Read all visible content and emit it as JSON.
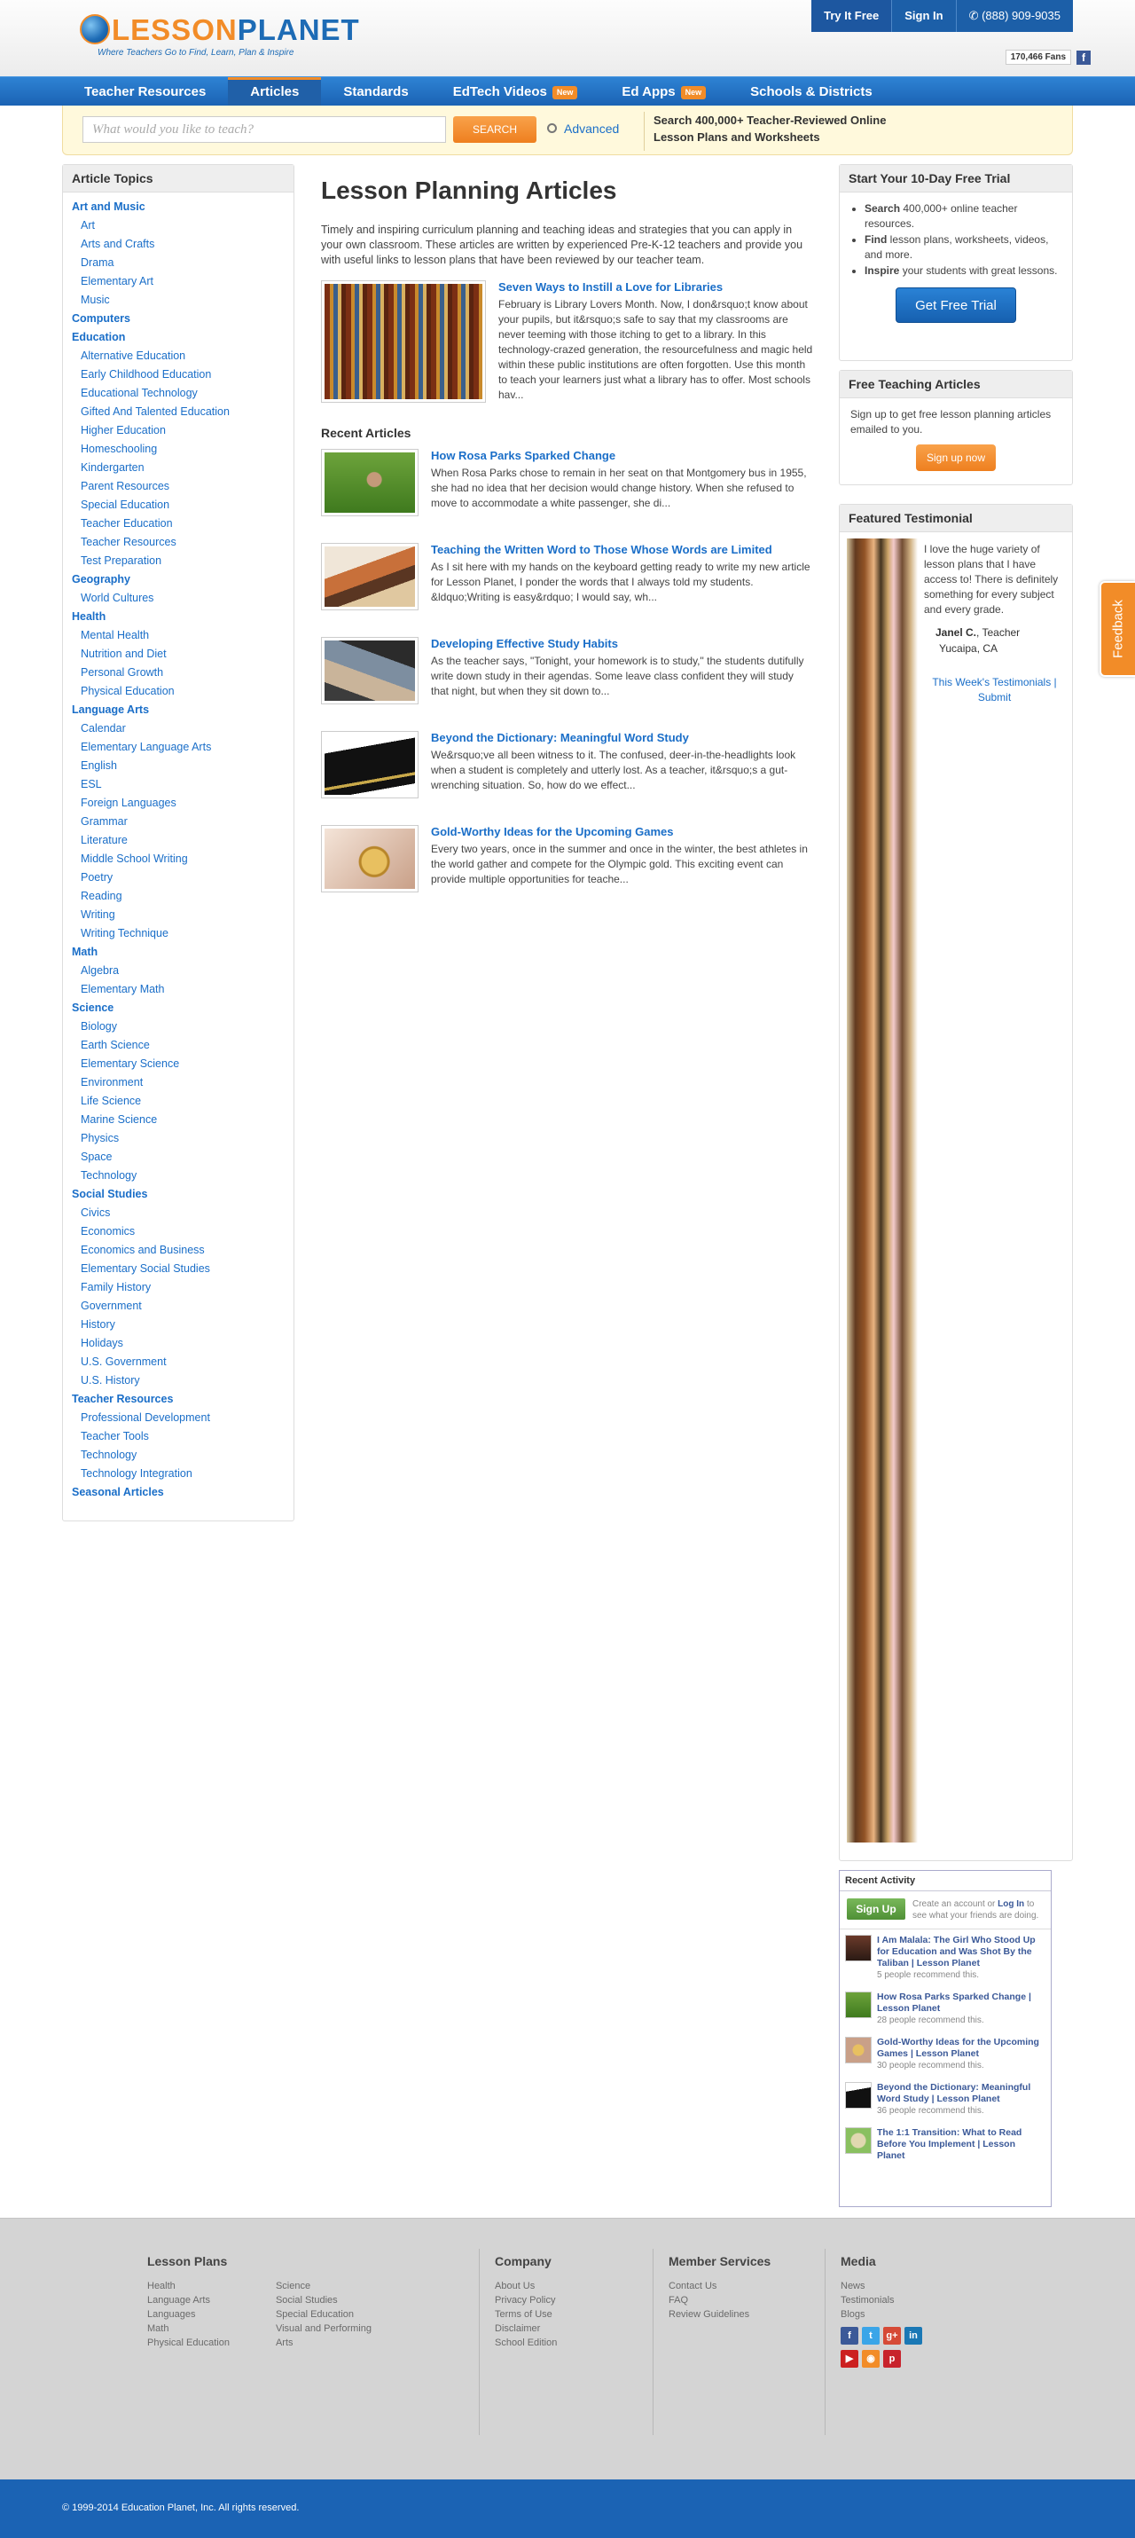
{
  "header": {
    "logo_part1": "LESSON",
    "logo_part2": "PLANET",
    "logo_tagline": "Where Teachers Go to Find, Learn, Plan & Inspire",
    "try_it_free": "Try It Free",
    "sign_in": "Sign In",
    "phone": "(888) 909-9035",
    "fans": "170,466 Fans"
  },
  "nav": {
    "items": [
      {
        "label": "Teacher Resources"
      },
      {
        "label": "Articles"
      },
      {
        "label": "Standards"
      },
      {
        "label": "EdTech Videos",
        "badge": "New"
      },
      {
        "label": "Ed Apps",
        "badge": "New"
      },
      {
        "label": "Schools & Districts"
      }
    ]
  },
  "search": {
    "placeholder": "What would you like to teach?",
    "button": "SEARCH",
    "advanced": "Advanced",
    "promo_line1": "Search 400,000+ Teacher-Reviewed Online",
    "promo_line2": "Lesson Plans and Worksheets"
  },
  "sidebar": {
    "title": "Article Topics",
    "topics": [
      {
        "label": "Art and Music",
        "level": "cat"
      },
      {
        "label": "Art",
        "level": "sub"
      },
      {
        "label": "Arts and Crafts",
        "level": "sub"
      },
      {
        "label": "Drama",
        "level": "sub"
      },
      {
        "label": "Elementary Art",
        "level": "sub"
      },
      {
        "label": "Music",
        "level": "sub"
      },
      {
        "label": "Computers",
        "level": "cat"
      },
      {
        "label": "Education",
        "level": "cat"
      },
      {
        "label": "Alternative Education",
        "level": "sub"
      },
      {
        "label": "Early Childhood Education",
        "level": "sub"
      },
      {
        "label": "Educational Technology",
        "level": "sub"
      },
      {
        "label": "Gifted And Talented Education",
        "level": "sub"
      },
      {
        "label": "Higher Education",
        "level": "sub"
      },
      {
        "label": "Homeschooling",
        "level": "sub"
      },
      {
        "label": "Kindergarten",
        "level": "sub"
      },
      {
        "label": "Parent Resources",
        "level": "sub"
      },
      {
        "label": "Special Education",
        "level": "sub"
      },
      {
        "label": "Teacher Education",
        "level": "sub"
      },
      {
        "label": "Teacher Resources",
        "level": "sub"
      },
      {
        "label": "Test Preparation",
        "level": "sub"
      },
      {
        "label": "Geography",
        "level": "cat"
      },
      {
        "label": "World Cultures",
        "level": "sub"
      },
      {
        "label": "Health",
        "level": "cat"
      },
      {
        "label": "Mental Health",
        "level": "sub"
      },
      {
        "label": "Nutrition and Diet",
        "level": "sub"
      },
      {
        "label": "Personal Growth",
        "level": "sub"
      },
      {
        "label": "Physical Education",
        "level": "sub"
      },
      {
        "label": "Language Arts",
        "level": "cat"
      },
      {
        "label": "Calendar",
        "level": "sub"
      },
      {
        "label": "Elementary Language Arts",
        "level": "sub"
      },
      {
        "label": "English",
        "level": "sub"
      },
      {
        "label": "ESL",
        "level": "sub"
      },
      {
        "label": "Foreign Languages",
        "level": "sub"
      },
      {
        "label": "Grammar",
        "level": "sub"
      },
      {
        "label": "Literature",
        "level": "sub"
      },
      {
        "label": "Middle School Writing",
        "level": "sub"
      },
      {
        "label": "Poetry",
        "level": "sub"
      },
      {
        "label": "Reading",
        "level": "sub"
      },
      {
        "label": "Writing",
        "level": "sub"
      },
      {
        "label": "Writing Technique",
        "level": "sub"
      },
      {
        "label": "Math",
        "level": "cat"
      },
      {
        "label": "Algebra",
        "level": "sub"
      },
      {
        "label": "Elementary Math",
        "level": "sub"
      },
      {
        "label": "Science",
        "level": "cat"
      },
      {
        "label": "Biology",
        "level": "sub"
      },
      {
        "label": "Earth Science",
        "level": "sub"
      },
      {
        "label": "Elementary Science",
        "level": "sub"
      },
      {
        "label": "Environment",
        "level": "sub"
      },
      {
        "label": "Life Science",
        "level": "sub"
      },
      {
        "label": "Marine Science",
        "level": "sub"
      },
      {
        "label": "Physics",
        "level": "sub"
      },
      {
        "label": "Space",
        "level": "sub"
      },
      {
        "label": "Technology",
        "level": "sub"
      },
      {
        "label": "Social Studies",
        "level": "cat"
      },
      {
        "label": "Civics",
        "level": "sub"
      },
      {
        "label": "Economics",
        "level": "sub"
      },
      {
        "label": "Economics and Business",
        "level": "sub"
      },
      {
        "label": "Elementary Social Studies",
        "level": "sub"
      },
      {
        "label": "Family History",
        "level": "sub"
      },
      {
        "label": "Government",
        "level": "sub"
      },
      {
        "label": "History",
        "level": "sub"
      },
      {
        "label": "Holidays",
        "level": "sub"
      },
      {
        "label": "U.S. Government",
        "level": "sub"
      },
      {
        "label": "U.S. History",
        "level": "sub"
      },
      {
        "label": "Teacher Resources",
        "level": "cat"
      },
      {
        "label": "Professional Development",
        "level": "sub"
      },
      {
        "label": "Teacher Tools",
        "level": "sub"
      },
      {
        "label": "Technology",
        "level": "sub"
      },
      {
        "label": "Technology Integration",
        "level": "sub"
      },
      {
        "label": "Seasonal Articles",
        "level": "cat"
      }
    ]
  },
  "main": {
    "title": "Lesson Planning Articles",
    "intro": "Timely and inspiring curriculum planning and teaching ideas and strategies that you can apply in your own classroom. These articles are written by experienced Pre-K-12 teachers and provide you with useful links to lesson plans that have been reviewed by our teacher team.",
    "featured": {
      "title": "Seven Ways to Instill a Love for Libraries",
      "text": "February is Library Lovers Month. Now, I don&rsquo;t know about your pupils, but it&rsquo;s safe to say that my classrooms are never teeming with those itching to get to a library. In this technology-crazed generation, the resourcefulness and magic held within these public institutions are often forgotten. Use this month to teach your learners just what a library has to offer. Most schools hav..."
    },
    "recent_heading": "Recent Articles",
    "recent": [
      {
        "title": "How Rosa Parks Sparked Change",
        "text": "When Rosa Parks chose to remain in her seat on that Montgomery bus in 1955, she had no idea that her decision would change history. When she refused to move to accommodate a white passenger, she di..."
      },
      {
        "title": "Teaching the Written Word to Those Whose Words are Limited",
        "text": "As I sit here with my hands on the keyboard getting ready to write my new article for Lesson Planet, I ponder the words that I always told my students. &ldquo;Writing is easy&rdquo; I would say, wh..."
      },
      {
        "title": "Developing Effective Study Habits",
        "text": "As the teacher says, \"Tonight, your homework is to study,\" the students dutifully write down study in their agendas. Some leave class confident they will study that night, but when they sit down to..."
      },
      {
        "title": "Beyond the Dictionary: Meaningful Word Study",
        "text": "We&rsquo;ve all been witness to it. The confused, deer-in-the-headlights look when a student is completely and utterly lost. As a teacher, it&rsquo;s a gut-wrenching situation. So, how do we effect..."
      },
      {
        "title": "Gold-Worthy Ideas for the Upcoming Games",
        "text": "Every two years, once in the summer and once in the winter, the best athletes in the world gather and compete for the Olympic gold. This exciting event can provide multiple opportunities for teache..."
      }
    ]
  },
  "trial": {
    "title": "Start Your 10-Day Free Trial",
    "b1_bold": "Search",
    "b1_rest": " 400,000+ online teacher resources.",
    "b2_bold": "Find",
    "b2_rest": " lesson plans, worksheets, videos, and more.",
    "b3_bold": "Inspire",
    "b3_rest": " your students with great lessons.",
    "button": "Get Free Trial"
  },
  "free_articles": {
    "title": "Free Teaching Articles",
    "text": "Sign up to get free lesson planning articles emailed to you.",
    "button": "Sign up now"
  },
  "testimonial": {
    "title": "Featured Testimonial",
    "quote": "I love the huge variety of lesson plans that I have access to! There is definitely something for every subject and every grade.",
    "name": "Janel C.",
    "role": ", Teacher",
    "location": "Yucaipa, CA",
    "link1": "This Week's Testimonials",
    "sep": " | ",
    "link2": "Submit"
  },
  "activity": {
    "title": "Recent Activity",
    "signup": "Sign Up",
    "cta_pre": "Create an account or ",
    "cta_link": "Log In",
    "cta_post": " to see what your friends are doing.",
    "items": [
      {
        "title": "I Am Malala: The Girl Who Stood Up for Education and Was Shot By the Taliban | Lesson Planet",
        "meta": "5 people recommend this."
      },
      {
        "title": "How Rosa Parks Sparked Change | Lesson Planet",
        "meta": "28 people recommend this."
      },
      {
        "title": "Gold-Worthy Ideas for the Upcoming Games | Lesson Planet",
        "meta": "30 people recommend this."
      },
      {
        "title": "Beyond the Dictionary: Meaningful Word Study | Lesson Planet",
        "meta": "36 people recommend this."
      },
      {
        "title": "The 1:1 Transition: What to Read Before You Implement | Lesson Planet",
        "meta": ""
      }
    ]
  },
  "feedback": "Feedback",
  "footer": {
    "lesson_plans": "Lesson Plans",
    "lp_col1": [
      "Health",
      "Language Arts",
      "Languages",
      "Math",
      "Physical Education"
    ],
    "lp_col2": [
      "Science",
      "Social Studies",
      "Special Education",
      "Visual and Performing",
      "Arts"
    ],
    "company": "Company",
    "company_links": [
      "About Us",
      "Privacy Policy",
      "Terms of Use",
      "Disclaimer",
      "School Edition"
    ],
    "member": "Member Services",
    "member_links": [
      "Contact Us",
      "FAQ",
      "Review Guidelines"
    ],
    "media": "Media",
    "media_links": [
      "News",
      "Testimonials",
      "Blogs"
    ],
    "copyright": "© 1999-2014 Education Planet, Inc. All rights reserved."
  }
}
